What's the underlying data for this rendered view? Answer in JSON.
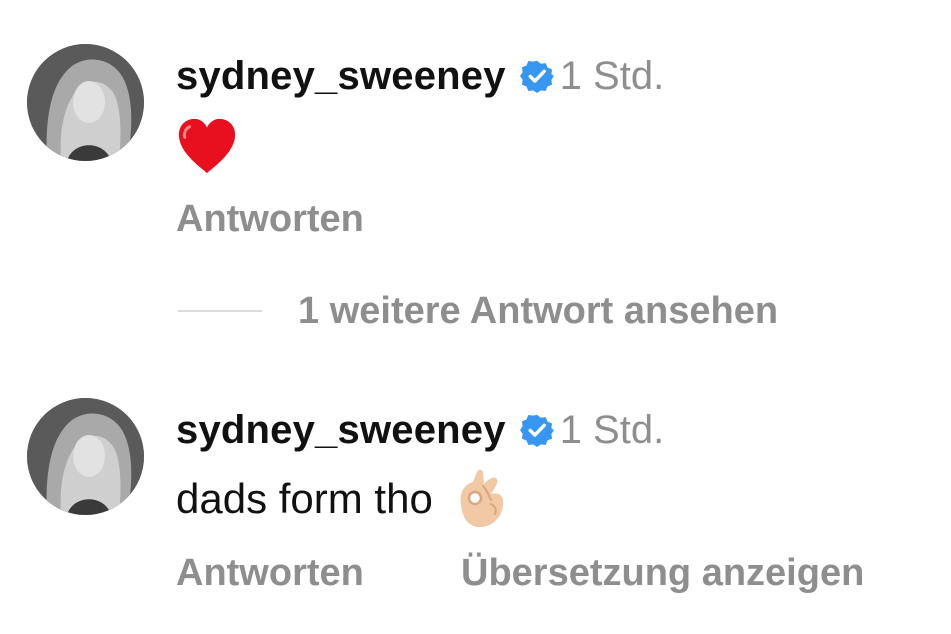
{
  "comments": [
    {
      "username": "sydney_sweeney",
      "verified": true,
      "timestamp": "1 Std.",
      "text": "",
      "emoji": "red-heart",
      "actions": {
        "reply": "Antworten"
      }
    },
    {
      "username": "sydney_sweeney",
      "verified": true,
      "timestamp": "1 Std.",
      "text": "dads form tho",
      "emoji": "ok-hand-light-skin",
      "actions": {
        "reply": "Antworten",
        "translate": "Übersetzung anzeigen"
      }
    }
  ],
  "thread": {
    "more_replies": "1 weitere Antwort ansehen"
  },
  "colors": {
    "primary_text": "#111111",
    "secondary_text": "#8e8e8e",
    "verified_blue": "#3797f0",
    "divider": "#dbdbdb"
  }
}
